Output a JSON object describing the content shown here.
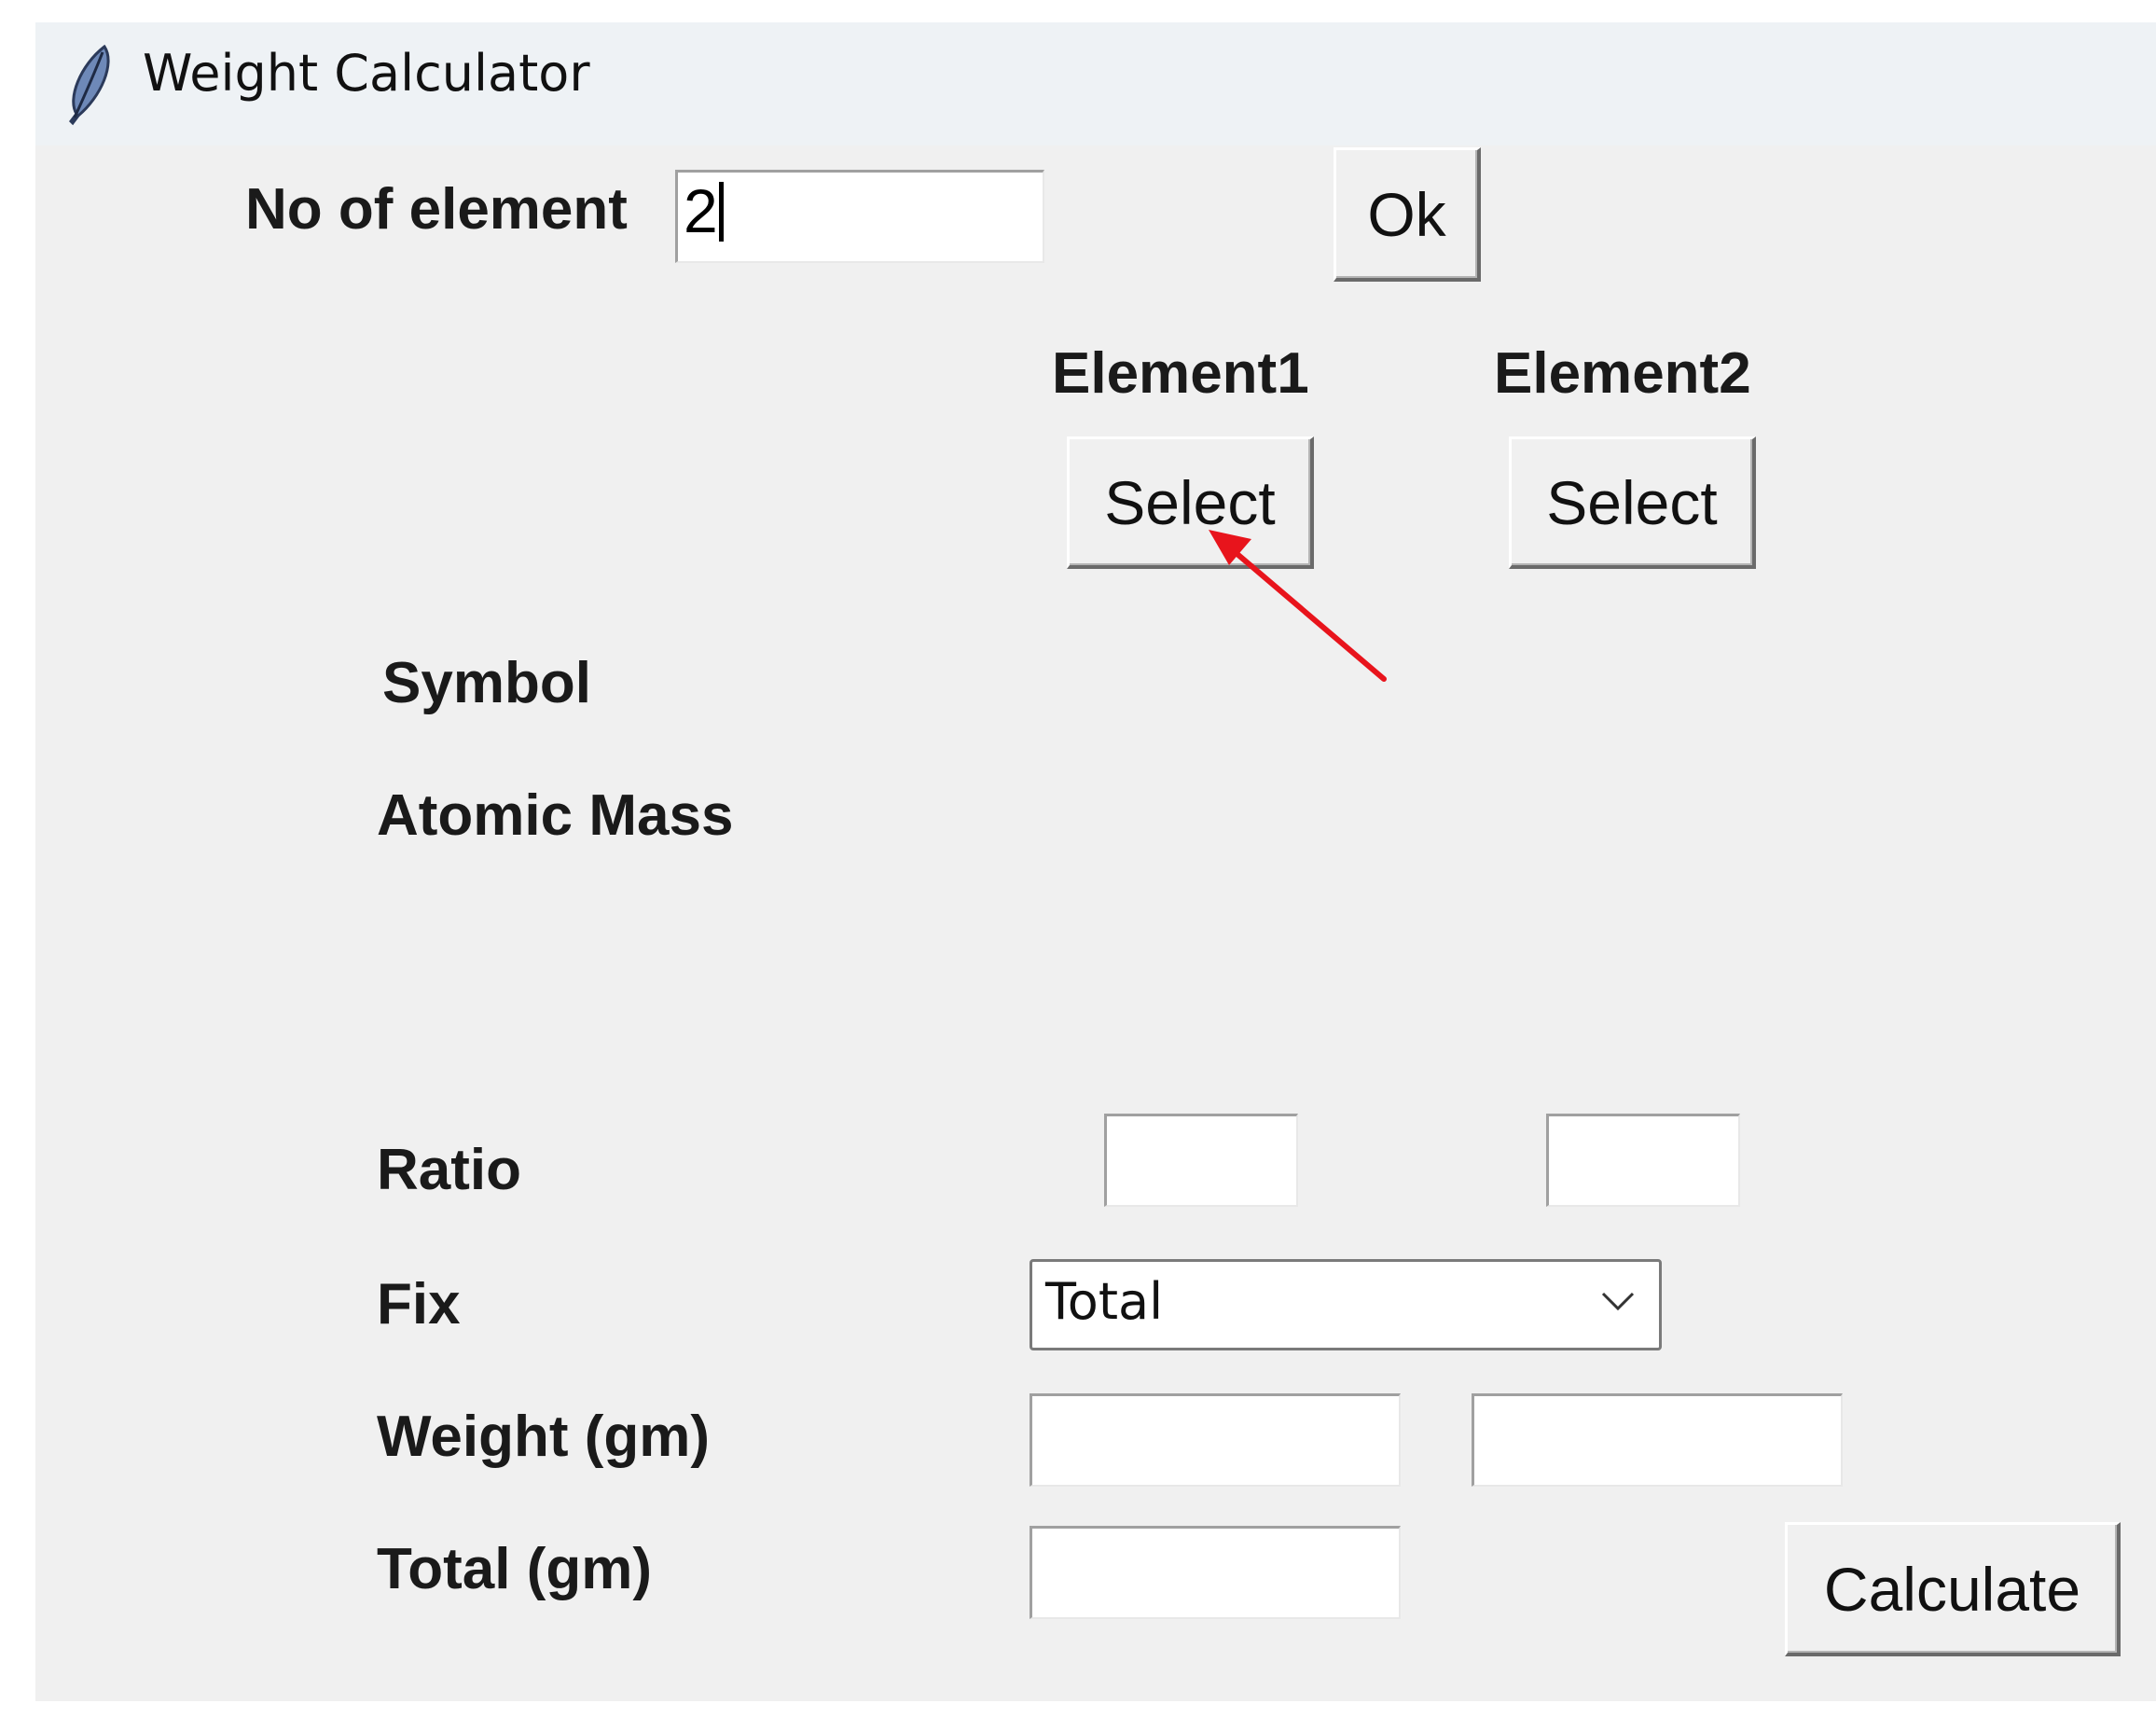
{
  "window": {
    "title": "Weight Calculator",
    "icon": "feather-icon"
  },
  "count_row": {
    "label": "No of element",
    "value": "2",
    "ok_label": "Ok"
  },
  "elements": [
    {
      "header": "Element1",
      "select_label": "Select"
    },
    {
      "header": "Element2",
      "select_label": "Select"
    }
  ],
  "rows": {
    "symbol_label": "Symbol",
    "atomic_mass_label": "Atomic Mass",
    "ratio_label": "Ratio",
    "fix_label": "Fix",
    "weight_label": "Weight (gm)",
    "total_label": "Total (gm)"
  },
  "fix": {
    "selected": "Total"
  },
  "calculate_label": "Calculate",
  "annotation": {
    "type": "red-arrow",
    "color": "#e8141c",
    "points_to": "Element1 Select button"
  }
}
